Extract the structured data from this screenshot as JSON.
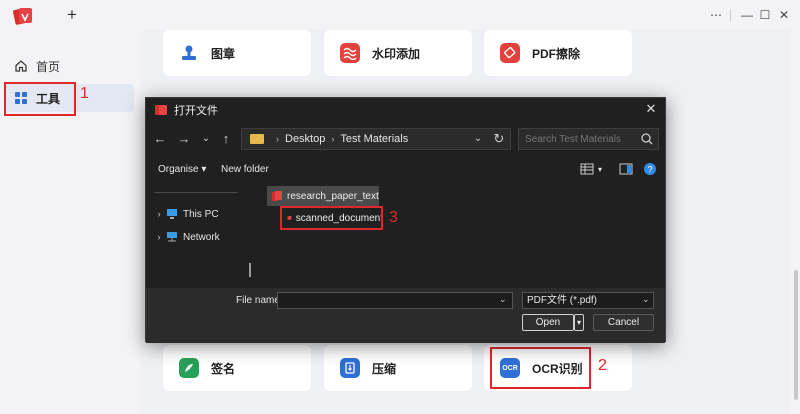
{
  "titlebar": {
    "new_tab": "+",
    "more": "⋯",
    "minimize": "—",
    "maximize": "☐",
    "close": "✕"
  },
  "sidebar": {
    "items": [
      {
        "label": "首页",
        "icon": "home-icon"
      },
      {
        "label": "工具",
        "icon": "grid-icon",
        "active": true
      }
    ]
  },
  "tools": {
    "row1": [
      {
        "label": "图章",
        "icon": "stamp-icon",
        "color": "#2f6fd6"
      },
      {
        "label": "水印添加",
        "icon": "watermark-icon",
        "color": "#e2413c"
      },
      {
        "label": "PDF擦除",
        "icon": "eraser-icon",
        "color": "#e2413c"
      }
    ],
    "row2": [
      {
        "label": "签名",
        "icon": "signature-icon",
        "color": "#27a05a"
      },
      {
        "label": "压缩",
        "icon": "compress-icon",
        "color": "#2f6fd6"
      },
      {
        "label": "OCR识别",
        "icon": "ocr-icon",
        "color": "#2f6fd6",
        "icon_text": "OCR"
      }
    ]
  },
  "annotations": [
    "1",
    "2",
    "3"
  ],
  "dialog": {
    "title": "打开文件",
    "close": "✕",
    "nav": {
      "back": "←",
      "forward": "→",
      "recent": "⌄",
      "up": "↑"
    },
    "address": {
      "segments": [
        "Desktop",
        "Test Materials"
      ],
      "separator": "›"
    },
    "refresh": "↻",
    "search_placeholder": "Search Test Materials",
    "toolbar": {
      "organise": "Organise ▾",
      "new_folder": "New folder"
    },
    "tree": [
      {
        "label": "This PC",
        "icon": "computer-icon"
      },
      {
        "label": "Network",
        "icon": "network-icon"
      }
    ],
    "files": [
      {
        "name": "research_paper_text",
        "selected": true
      },
      {
        "name": "scanned_document",
        "selected": false
      }
    ],
    "file_name_label": "File name:",
    "file_name_value": "",
    "file_type": "PDF文件 (*.pdf)",
    "open_label": "Open",
    "cancel_label": "Cancel"
  }
}
